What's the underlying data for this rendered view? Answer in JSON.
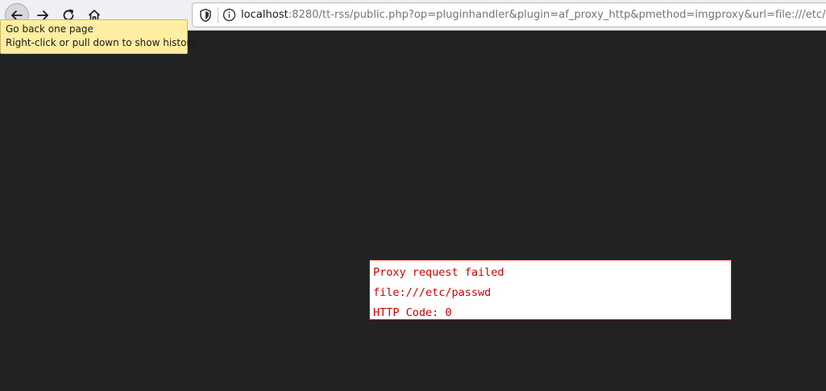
{
  "browser": {
    "address_bar": {
      "host": "localhost",
      "rest": ":8280/tt-rss/public.php?op=pluginhandler&plugin=af_proxy_http&pmethod=imgproxy&url=file:///etc/passwd"
    },
    "tooltip": {
      "line1": "Go back one page",
      "line2": "Right-click or pull down to show history"
    }
  },
  "page": {
    "error_lines": [
      "Proxy request failed",
      "file:///etc/passwd",
      "HTTP Code: 0"
    ]
  },
  "colors": {
    "page_background": "#222222",
    "error_text": "#cc0000",
    "error_border": "#e00000",
    "tooltip_background": "#fdeea2"
  }
}
